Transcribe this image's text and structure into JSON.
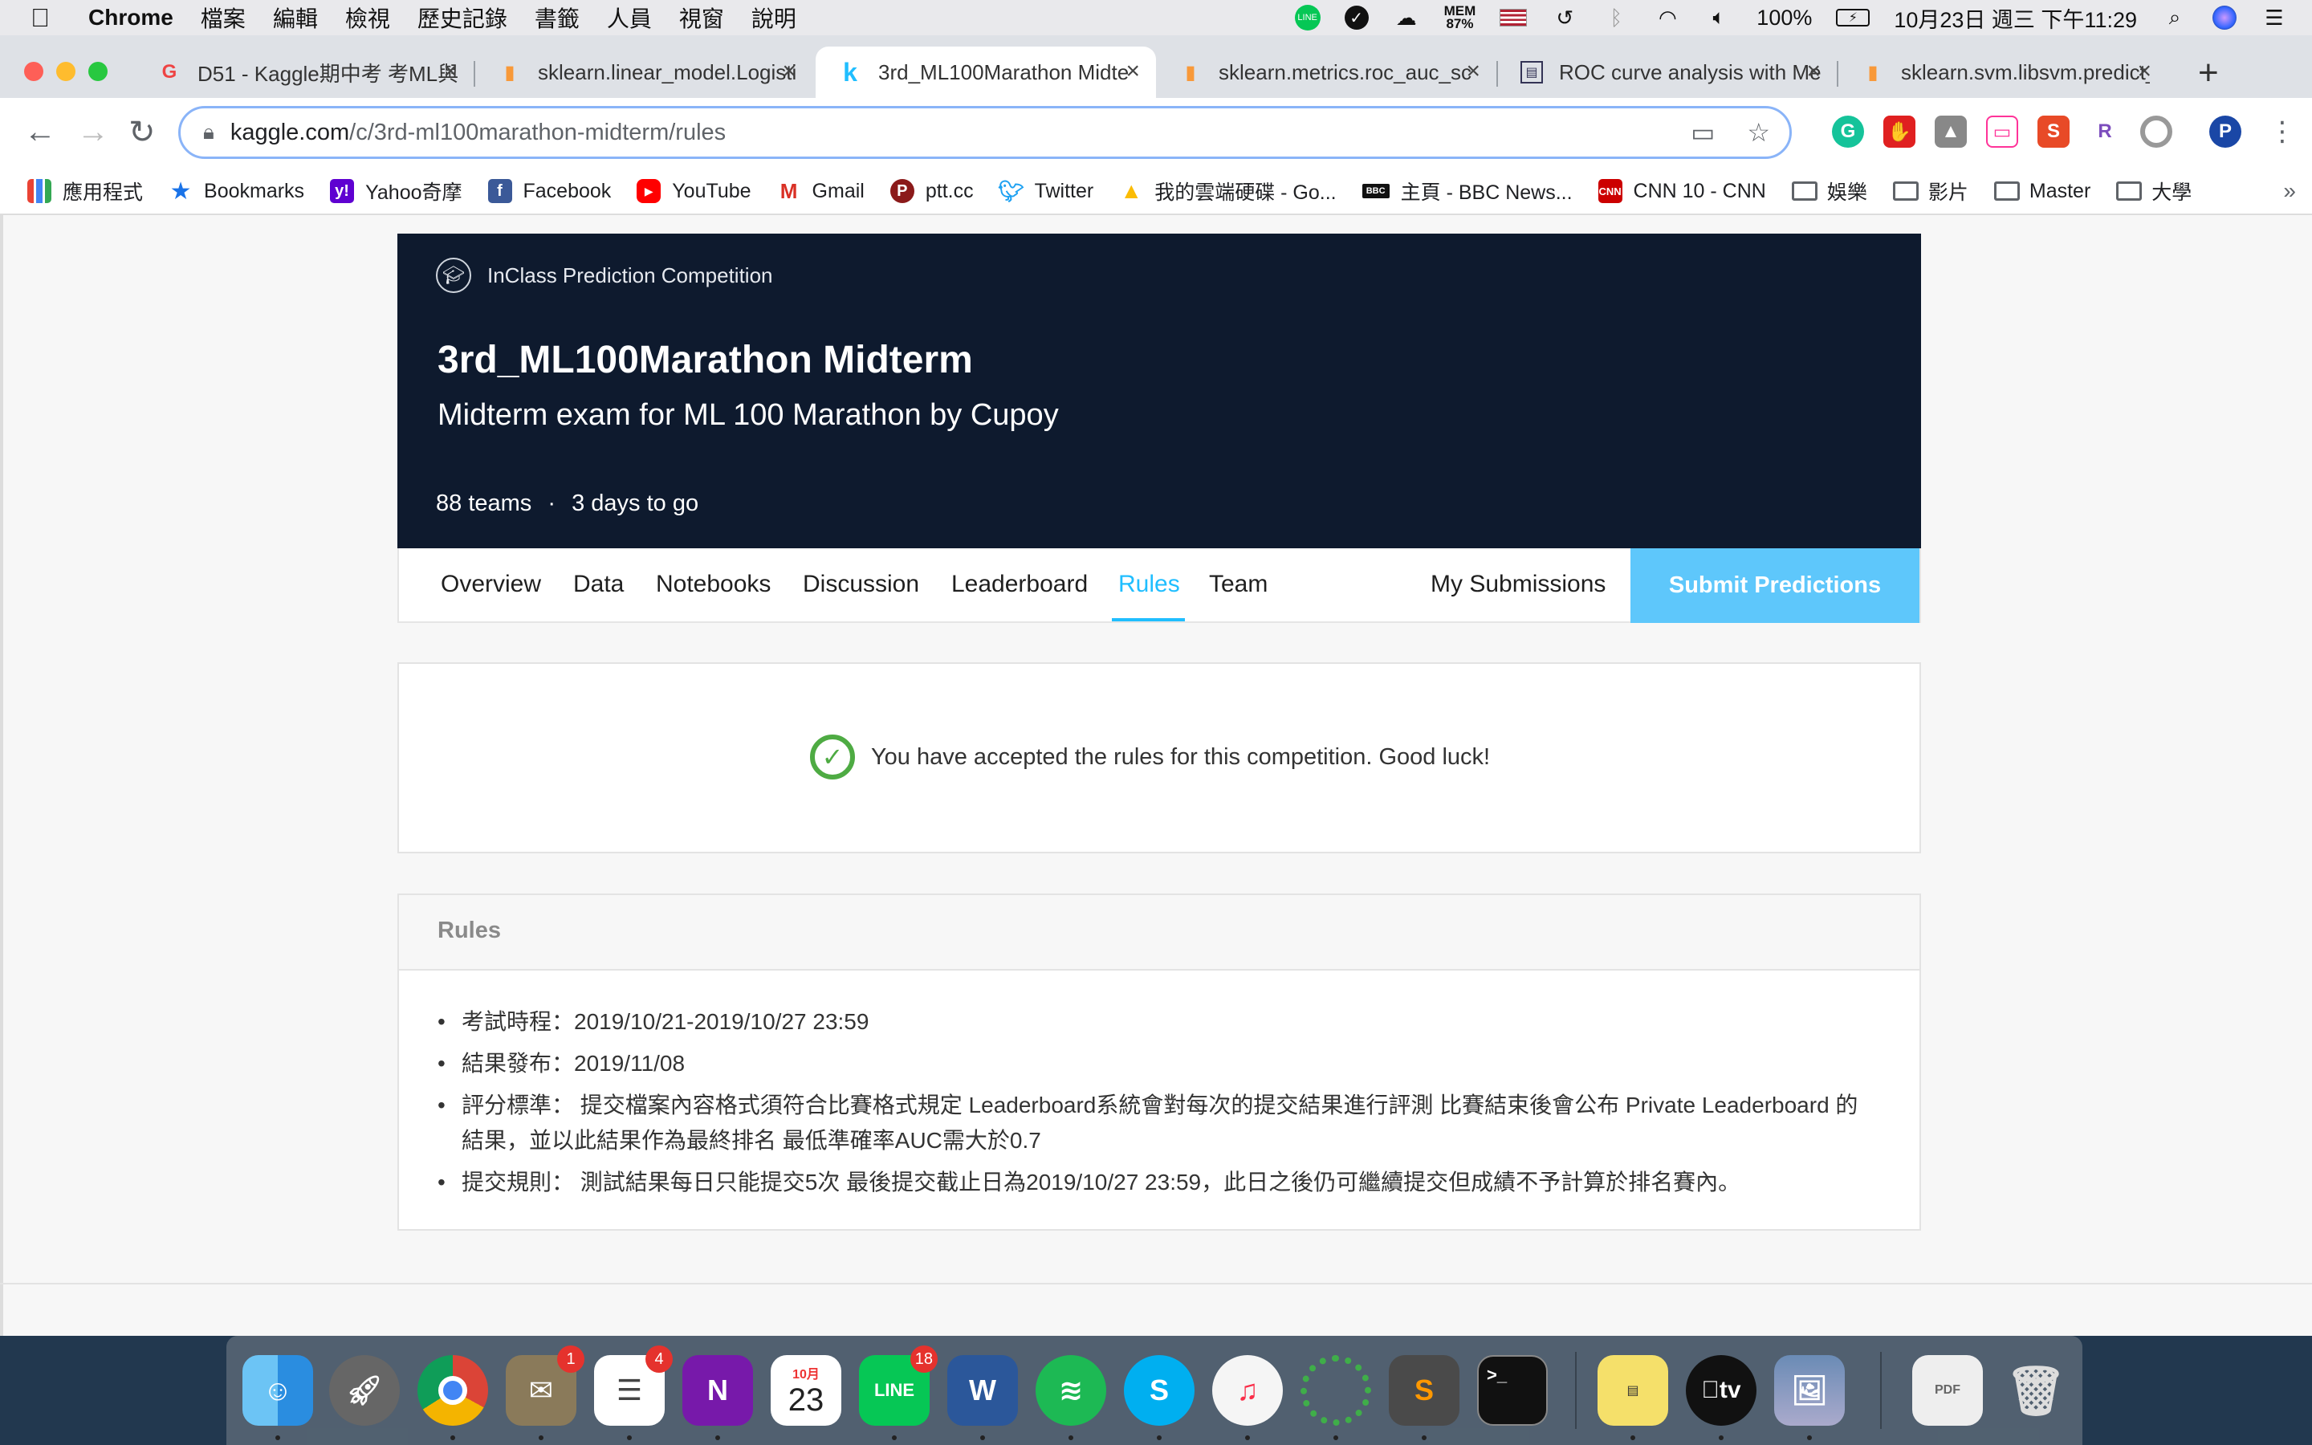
{
  "menubar": {
    "app_name": "Chrome",
    "menus": [
      "檔案",
      "編輯",
      "檢視",
      "歷史記錄",
      "書籤",
      "人員",
      "視窗",
      "說明"
    ],
    "mem_label": "MEM",
    "mem_value": "87%",
    "battery": "100%",
    "clock": "10月23日 週三 下午11:29"
  },
  "tabs": [
    {
      "title": "D51 - Kaggle期中考 考ML與",
      "icon": "cupoy-icon"
    },
    {
      "title": "sklearn.linear_model.Logisti",
      "icon": "sklearn-icon"
    },
    {
      "title": "3rd_ML100Marathon Midte",
      "icon": "kaggle-icon"
    },
    {
      "title": "sklearn.metrics.roc_auc_sc",
      "icon": "sklearn-icon"
    },
    {
      "title": "ROC curve analysis with Me",
      "icon": "chart-icon"
    },
    {
      "title": "sklearn.svm.libsvm.predict_",
      "icon": "sklearn-icon"
    }
  ],
  "omnibox": {
    "host": "kaggle.com",
    "path": "/c/3rd-ml100marathon-midterm/rules"
  },
  "profile_initial": "P",
  "bookmarks": [
    {
      "label": "應用程式"
    },
    {
      "label": "Bookmarks"
    },
    {
      "label": "Yahoo奇摩"
    },
    {
      "label": "Facebook"
    },
    {
      "label": "YouTube"
    },
    {
      "label": "Gmail"
    },
    {
      "label": "ptt.cc"
    },
    {
      "label": "Twitter"
    },
    {
      "label": "我的雲端硬碟 - Go..."
    },
    {
      "label": "主頁 - BBC News..."
    },
    {
      "label": "CNN 10 - CNN"
    },
    {
      "label": "娛樂"
    },
    {
      "label": "影片"
    },
    {
      "label": "Master"
    },
    {
      "label": "大學"
    }
  ],
  "competition": {
    "badge": "InClass Prediction Competition",
    "title": "3rd_ML100Marathon Midterm",
    "subtitle": "Midterm exam for ML 100 Marathon by Cupoy",
    "teams": "88 teams",
    "separator": "·",
    "time_left": "3 days to go"
  },
  "nav": {
    "tabs": [
      "Overview",
      "Data",
      "Notebooks",
      "Discussion",
      "Leaderboard",
      "Rules",
      "Team"
    ],
    "active": "Rules",
    "my_submissions": "My Submissions",
    "submit": "Submit Predictions"
  },
  "accepted": {
    "message": "You have accepted the rules for this competition. Good luck!"
  },
  "rules": {
    "heading": "Rules",
    "items": [
      "考試時程：2019/10/21-2019/10/27 23:59",
      "結果發布：2019/11/08",
      "評分標準： 提交檔案內容格式須符合比賽格式規定 Leaderboard系統會對每次的提交結果進行評測 比賽結束後會公布 Private Leaderboard 的結果，並以此結果作為最終排名 最低準確率AUC需大於0.7",
      "提交規則： 測試結果每日只能提交5次 最後提交截止日為2019/10/27 23:59，此日之後仍可繼續提交但成績不予計算於排名賽內。"
    ]
  },
  "dock": {
    "mail_badge": "1",
    "reminders_badge": "4",
    "line_badge": "18",
    "calendar_month": "10月",
    "calendar_day": "23",
    "line_label": "LINE",
    "tv_label": "tv"
  },
  "colors": {
    "hero_bg": "#0e1a2e",
    "accent": "#20beff",
    "submit_bg": "#5ec7fb",
    "check_green": "#4eab43"
  }
}
